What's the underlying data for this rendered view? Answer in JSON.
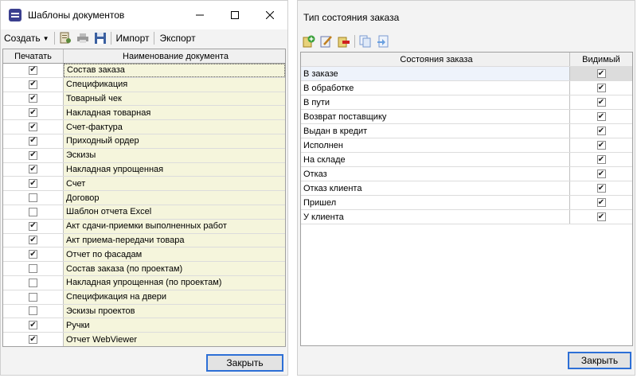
{
  "left_window": {
    "title": "Шаблоны документов",
    "toolbar": {
      "create_label": "Создать",
      "import_label": "Импорт",
      "export_label": "Экспорт"
    },
    "columns": {
      "print": "Печатать",
      "name": "Наименование документа"
    },
    "rows": [
      {
        "name": "Состав заказа",
        "checked": true
      },
      {
        "name": "Спецификация",
        "checked": true
      },
      {
        "name": "Товарный чек",
        "checked": true
      },
      {
        "name": "Накладная товарная",
        "checked": true
      },
      {
        "name": "Счет-фактура",
        "checked": true
      },
      {
        "name": "Приходный ордер",
        "checked": true
      },
      {
        "name": "Эскизы",
        "checked": true
      },
      {
        "name": "Накладная упрощенная",
        "checked": true
      },
      {
        "name": "Счет",
        "checked": true
      },
      {
        "name": "Договор",
        "checked": false
      },
      {
        "name": "Шаблон отчета Excel",
        "checked": false
      },
      {
        "name": "Акт сдачи-приемки выполненных работ",
        "checked": true
      },
      {
        "name": "Акт приема-передачи товара",
        "checked": true
      },
      {
        "name": "Отчет по фасадам",
        "checked": true
      },
      {
        "name": "Состав заказа (по проектам)",
        "checked": false
      },
      {
        "name": "Накладная упрощенная (по проектам)",
        "checked": false
      },
      {
        "name": "Спецификация на двери",
        "checked": false
      },
      {
        "name": "Эскизы проектов",
        "checked": false
      },
      {
        "name": "Ручки",
        "checked": true
      },
      {
        "name": "Отчет WebViewer",
        "checked": true
      }
    ],
    "close_label": "Закрыть"
  },
  "right_window": {
    "title": "Тип состояния заказа",
    "columns": {
      "state": "Состояния заказа",
      "visible": "Видимый"
    },
    "rows": [
      {
        "name": "В заказе",
        "visible": true
      },
      {
        "name": "В обработке",
        "visible": true
      },
      {
        "name": "В пути",
        "visible": true
      },
      {
        "name": "Возврат поставщику",
        "visible": true
      },
      {
        "name": "Выдан в кредит",
        "visible": true
      },
      {
        "name": "Исполнен",
        "visible": true
      },
      {
        "name": "На складе",
        "visible": true
      },
      {
        "name": "Отказ",
        "visible": true
      },
      {
        "name": "Отказ клиента",
        "visible": true
      },
      {
        "name": "Пришел",
        "visible": true
      },
      {
        "name": "У клиента",
        "visible": true
      }
    ],
    "close_label": "Закрыть"
  },
  "icons": {
    "app": "app-icon",
    "minimize": "minimize-icon",
    "maximize": "maximize-icon",
    "close": "close-icon",
    "edit_doc": "edit-document-icon",
    "printer": "printer-icon",
    "save": "save-icon",
    "add": "add-icon",
    "edit": "edit-icon",
    "delete": "delete-icon",
    "copy": "copy-icon",
    "export": "export-icon"
  },
  "colors": {
    "name_column_bg": "#f5f5dc",
    "focus_border": "#2d6fd6"
  }
}
